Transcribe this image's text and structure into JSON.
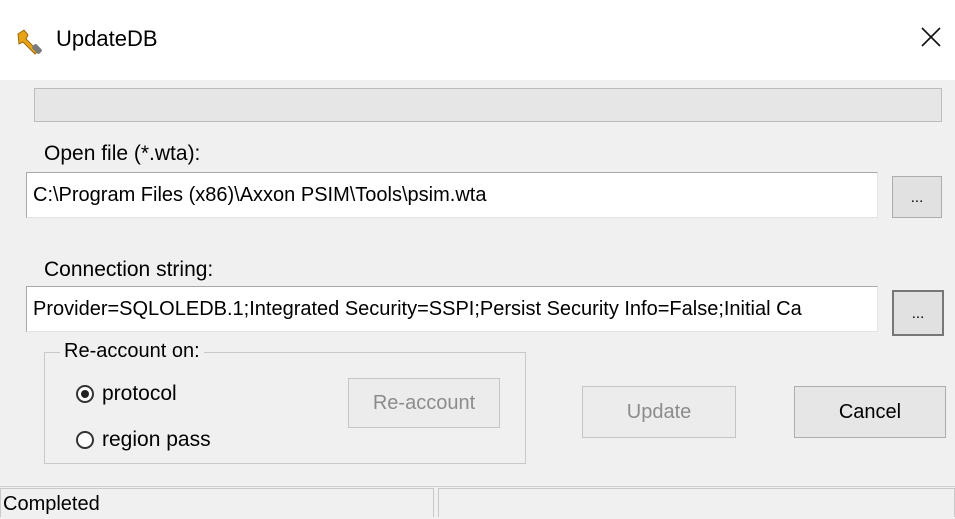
{
  "window": {
    "title": "UpdateDB",
    "icon": "wrench-icon",
    "close_label": "✕"
  },
  "progress": {
    "value": 0
  },
  "open_file": {
    "label": "Open file (*.wta):",
    "value": "C:\\Program Files (x86)\\Axxon PSIM\\Tools\\psim.wta",
    "browse_label": "..."
  },
  "connection": {
    "label": "Connection string:",
    "value": "Provider=SQLOLEDB.1;Integrated Security=SSPI;Persist Security Info=False;Initial Ca",
    "browse_label": "..."
  },
  "reaccount": {
    "group_label": "Re-account on:",
    "options": [
      {
        "label": "protocol",
        "selected": true
      },
      {
        "label": "region pass",
        "selected": false
      }
    ],
    "button_label": "Re-account"
  },
  "actions": {
    "update_label": "Update",
    "cancel_label": "Cancel"
  },
  "status": {
    "left": "Completed",
    "right": ""
  }
}
